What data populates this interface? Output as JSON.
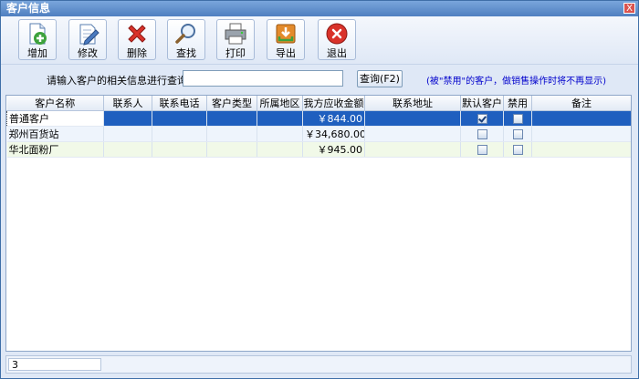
{
  "window": {
    "title": "客户信息",
    "close_label": "X"
  },
  "toolbar": {
    "buttons": [
      {
        "label": "增加",
        "icon": "add-document-icon"
      },
      {
        "label": "修改",
        "icon": "edit-icon"
      },
      {
        "label": "删除",
        "icon": "delete-x-icon"
      },
      {
        "label": "查找",
        "icon": "magnifier-icon"
      },
      {
        "label": "打印",
        "icon": "printer-icon"
      },
      {
        "label": "导出",
        "icon": "export-icon"
      },
      {
        "label": "退出",
        "icon": "exit-icon"
      }
    ]
  },
  "search": {
    "label": "请输入客户的相关信息进行查询：",
    "value": "",
    "button_label": "查询(F2)",
    "hint": "(被\"禁用\"的客户，做销售操作时将不再显示)"
  },
  "grid": {
    "columns": [
      "客户名称",
      "联系人",
      "联系电话",
      "客户类型",
      "所属地区",
      "我方应收金额",
      "联系地址",
      "默认客户",
      "禁用",
      "备注"
    ],
    "rows": [
      {
        "name": "普通客户",
        "contact": "",
        "phone": "",
        "type": "",
        "region": "",
        "receivable": "￥844.00",
        "address": "",
        "default": true,
        "disabled": false,
        "note": ""
      },
      {
        "name": "郑州百货站",
        "contact": "",
        "phone": "",
        "type": "",
        "region": "",
        "receivable": "￥34,680.00",
        "address": "",
        "default": false,
        "disabled": false,
        "note": ""
      },
      {
        "name": "华北面粉厂",
        "contact": "",
        "phone": "",
        "type": "",
        "region": "",
        "receivable": "￥945.00",
        "address": "",
        "default": false,
        "disabled": false,
        "note": ""
      }
    ]
  },
  "status": {
    "record_count": "3"
  },
  "colors": {
    "selected_row": "#1f5fbf",
    "hint_text": "#0000cc",
    "title_bar": "#5b8acb"
  }
}
